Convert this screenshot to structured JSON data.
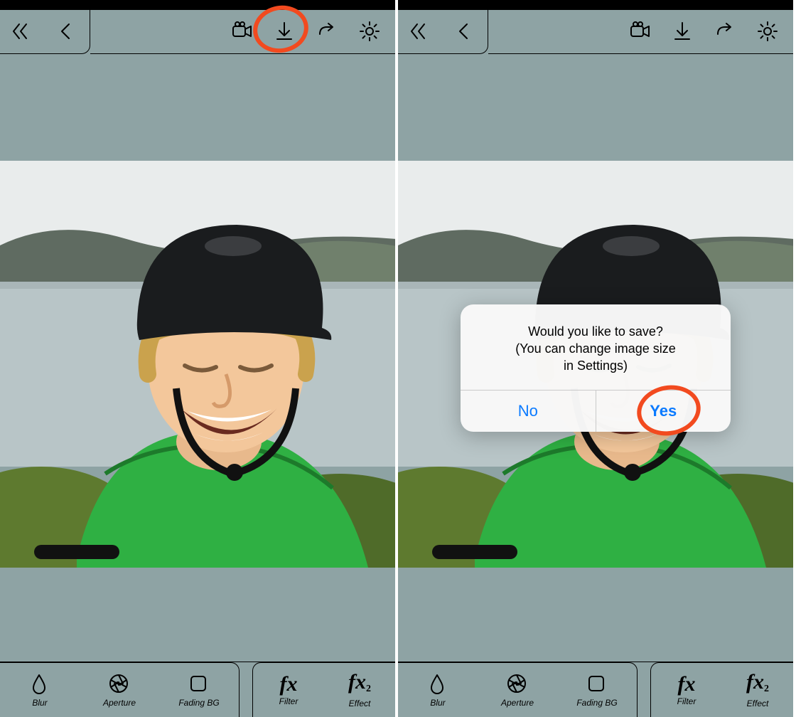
{
  "toolbar": {
    "icons": {
      "back_all": "double-chevron-left-icon",
      "back": "chevron-left-icon",
      "video": "video-camera-icon",
      "download": "download-icon",
      "share": "share-icon",
      "settings": "gear-icon"
    }
  },
  "bottom": {
    "items": [
      {
        "id": "blur",
        "label": "Blur",
        "icon": "drop-icon"
      },
      {
        "id": "aperture",
        "label": "Aperture",
        "icon": "aperture-icon"
      },
      {
        "id": "fading_bg",
        "label": "Fading BG",
        "icon": "square-icon"
      },
      {
        "id": "filter",
        "label": "Filter",
        "icon": "fx-icon"
      },
      {
        "id": "effect",
        "label": "Effect",
        "icon": "fx2-icon"
      }
    ]
  },
  "dialog": {
    "message_line1": "Would you like to save?",
    "message_line2": "(You can change image size",
    "message_line3": "in Settings)",
    "no_label": "No",
    "yes_label": "Yes"
  },
  "annotations": {
    "left_circle_target": "download-icon",
    "right_circle_target": "dialog-yes-button"
  },
  "photo": {
    "description": "Child wearing black bike helmet and green t-shirt, grinning, lake and hills in background"
  }
}
